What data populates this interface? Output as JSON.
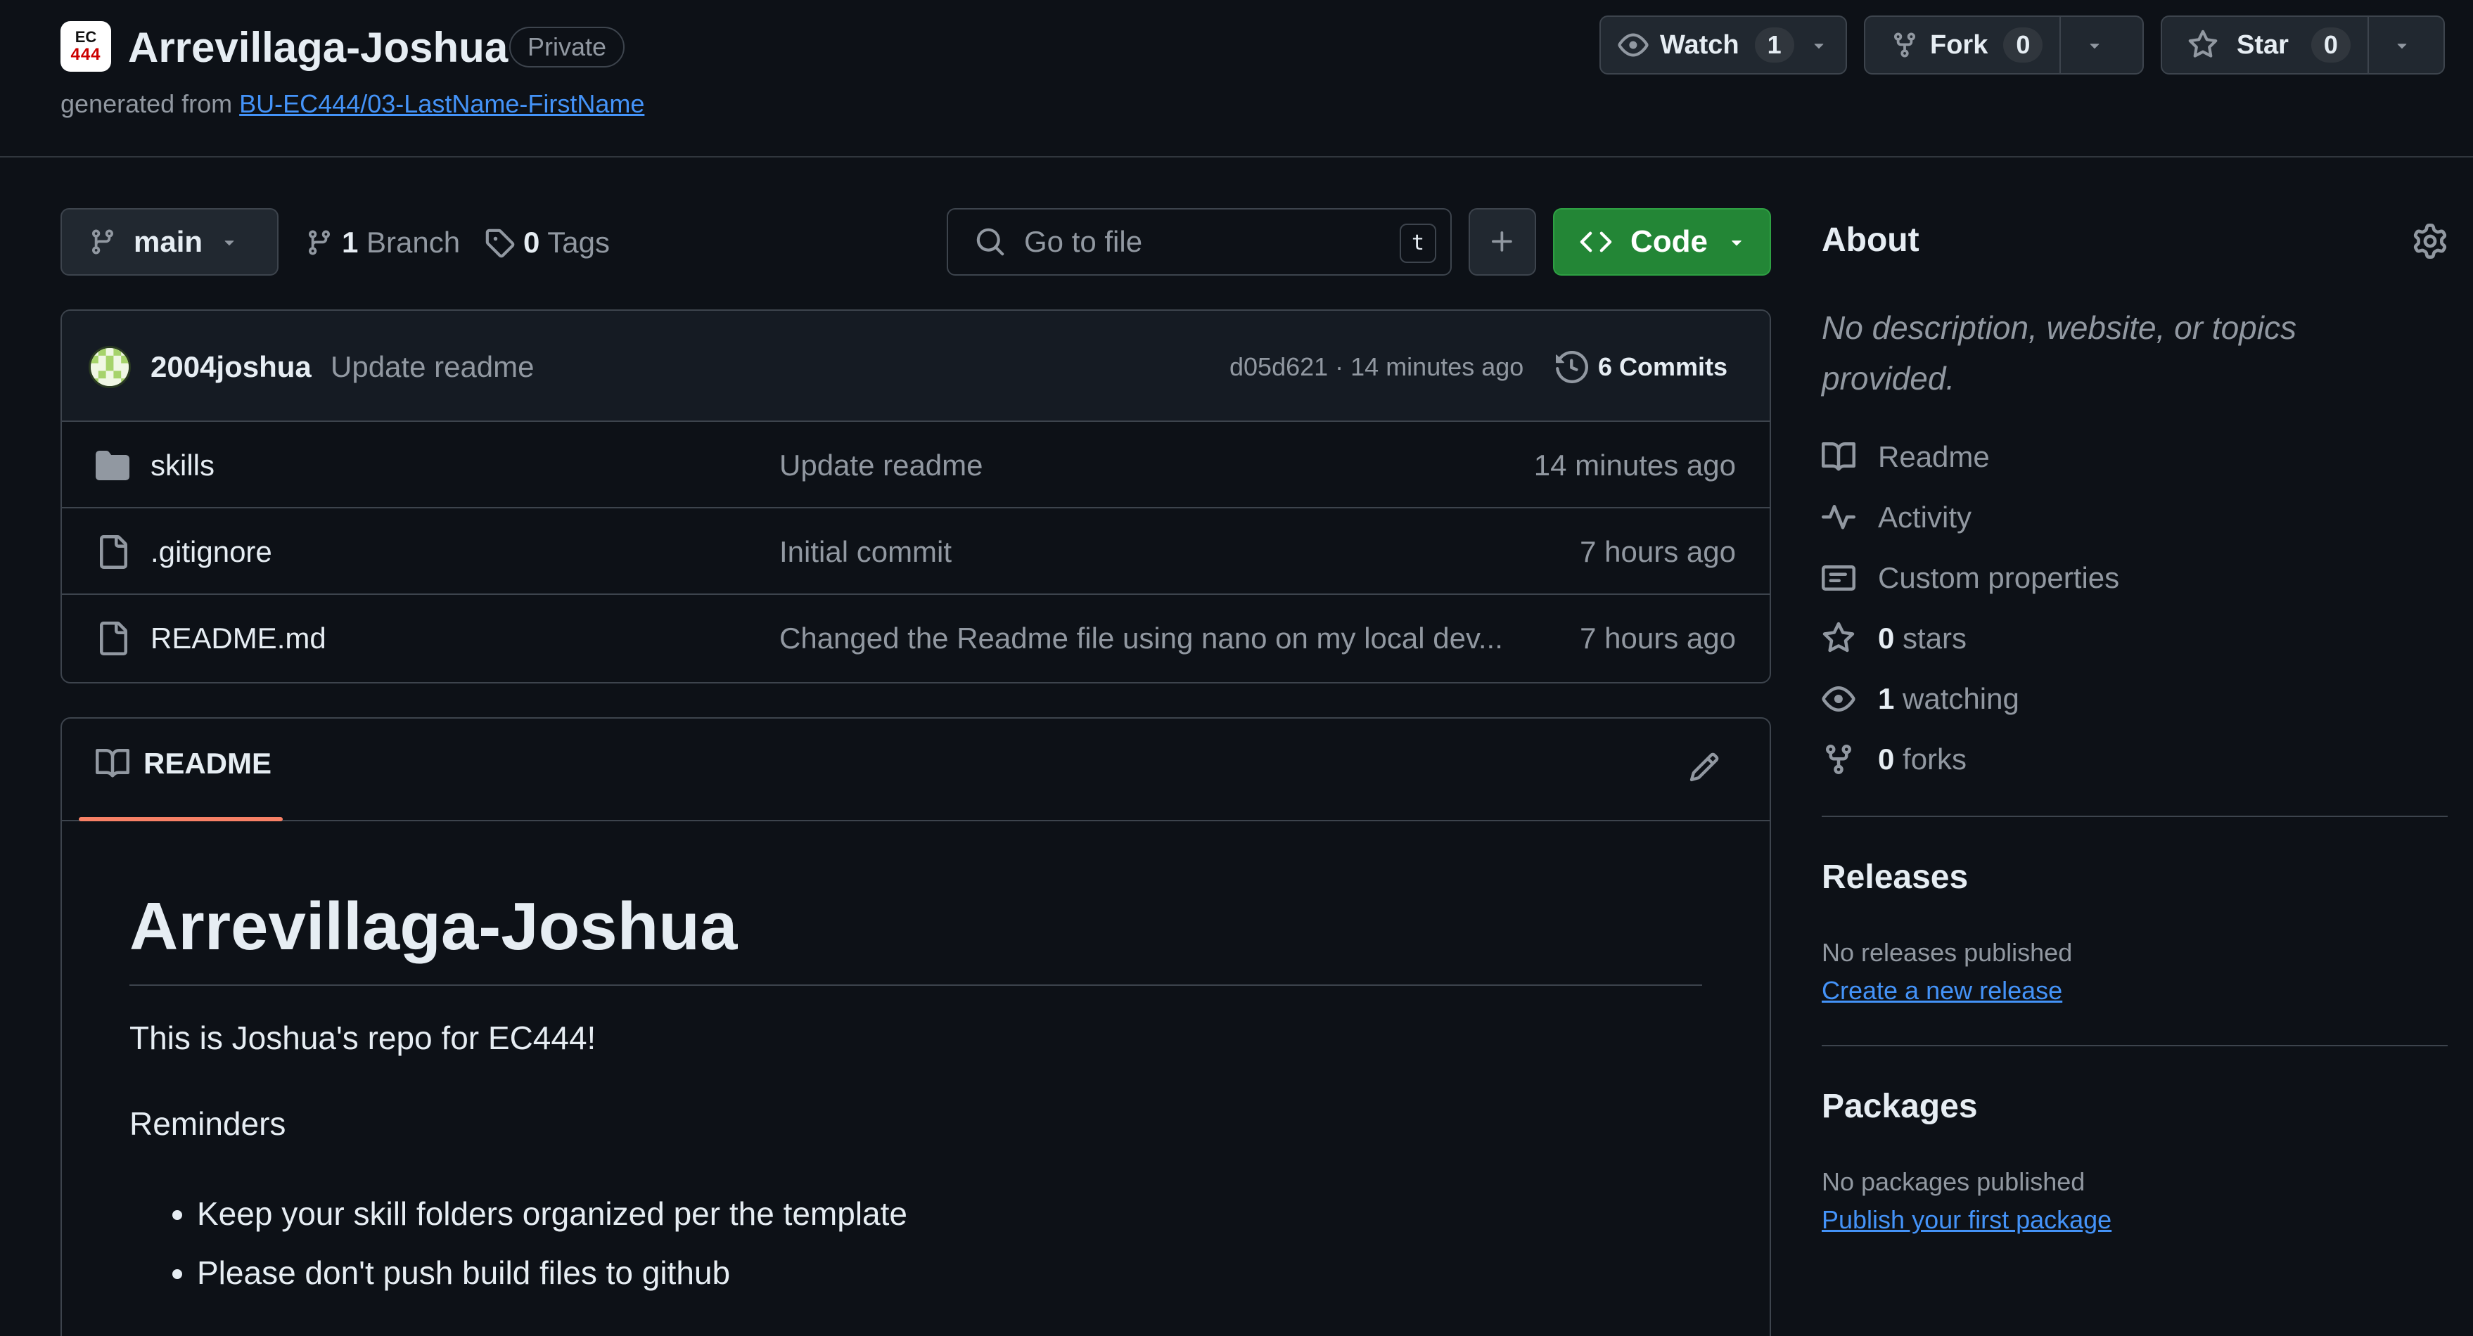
{
  "repo": {
    "name": "Arrevillaga-Joshua",
    "visibility": "Private",
    "generated_from_label": "generated from",
    "template_link": "BU-EC444/03-LastName-FirstName",
    "owner_avatar_text_top": "EC",
    "owner_avatar_text_bottom": "444"
  },
  "header_actions": {
    "watch": {
      "label": "Watch",
      "count": "1"
    },
    "fork": {
      "label": "Fork",
      "count": "0"
    },
    "star": {
      "label": "Star",
      "count": "0"
    }
  },
  "toolbar": {
    "branch": "main",
    "branch_count": "1",
    "branch_label": "Branch",
    "tag_count": "0",
    "tag_label": "Tags",
    "goto_placeholder": "Go to file",
    "goto_shortcut": "t",
    "code_label": "Code"
  },
  "latest_commit": {
    "author": "2004joshua",
    "message": "Update readme",
    "meta": "d05d621 · 14 minutes ago",
    "commits_label": "6 Commits"
  },
  "files": [
    {
      "type": "folder",
      "name": "skills",
      "message": "Update readme",
      "age": "14 minutes ago"
    },
    {
      "type": "file",
      "name": ".gitignore",
      "message": "Initial commit",
      "age": "7 hours ago"
    },
    {
      "type": "file",
      "name": "README.md",
      "message": "Changed the Readme file using nano on my local dev...",
      "age": "7 hours ago"
    }
  ],
  "readme": {
    "tab_label": "README",
    "heading": "Arrevillaga-Joshua",
    "paragraph1": "This is Joshua's repo for EC444!",
    "paragraph2": "Reminders",
    "list": [
      "Keep your skill folders organized per the template",
      "Please don't push build files to github"
    ]
  },
  "sidebar": {
    "about_title": "About",
    "description": "No description, website, or topics provided.",
    "items": [
      {
        "icon": "book-icon",
        "label": "Readme"
      },
      {
        "icon": "pulse-icon",
        "label": "Activity"
      },
      {
        "icon": "note-icon",
        "label": "Custom properties"
      },
      {
        "icon": "star-icon",
        "count": "0",
        "label": "stars"
      },
      {
        "icon": "eye-icon",
        "count": "1",
        "label": "watching"
      },
      {
        "icon": "fork-icon",
        "count": "0",
        "label": "forks"
      }
    ],
    "releases": {
      "title": "Releases",
      "subtitle": "No releases published",
      "link": "Create a new release"
    },
    "packages": {
      "title": "Packages",
      "subtitle": "No packages published",
      "link": "Publish your first package"
    }
  },
  "colors": {
    "background": "#0d1117",
    "border": "#3d444d",
    "accent_link": "#4493f8",
    "code_button": "#238636",
    "readme_tab_underline": "#f78166"
  }
}
